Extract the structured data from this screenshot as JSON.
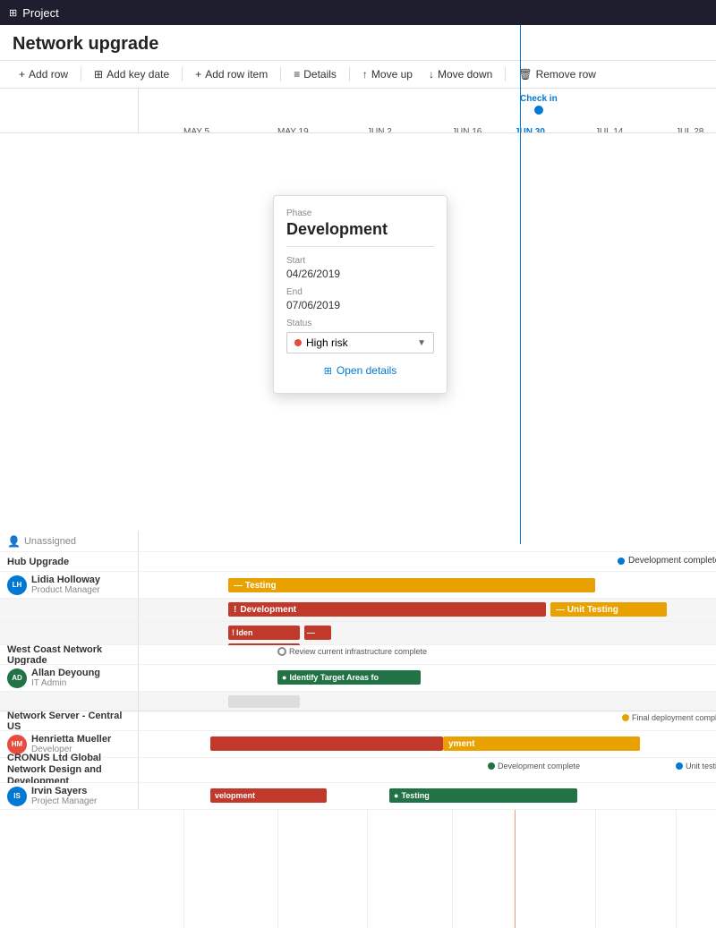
{
  "app": {
    "title": "Project"
  },
  "page": {
    "title": "Network upgrade"
  },
  "toolbar": {
    "buttons": [
      {
        "id": "add-row",
        "label": "Add row",
        "icon": "plus"
      },
      {
        "id": "add-key-date",
        "label": "Add key date",
        "icon": "grid"
      },
      {
        "id": "add-row-item",
        "label": "Add row item",
        "icon": "plus"
      },
      {
        "id": "details",
        "label": "Details",
        "icon": "details"
      },
      {
        "id": "move-up",
        "label": "Move up",
        "icon": "up"
      },
      {
        "id": "move-down",
        "label": "Move down",
        "icon": "down"
      },
      {
        "id": "remove-row",
        "label": "Remove row",
        "icon": "trash"
      }
    ]
  },
  "timeline": {
    "checkin_label": "Check in",
    "dates": [
      "MAY 5",
      "MAY 19",
      "JUN 2",
      "JUN 16",
      "JUN 30",
      "JUL 14",
      "JUL 28"
    ],
    "checkin_date": "JUN 30"
  },
  "sections": [
    {
      "id": "unassigned",
      "label": "Unassigned",
      "rows": []
    },
    {
      "id": "hub-upgrade",
      "label": "Hub Upgrade",
      "person_name": "Lidia Holloway",
      "person_role": "Product Manager",
      "avatar_initials": "LH",
      "avatar_color": "#0078d4",
      "bars": [
        {
          "label": "Testing",
          "color": "orange",
          "style": "left:115px;width:380px;top:4px;"
        },
        {
          "label": "Development",
          "color": "red",
          "style": "left:115px;width:310px;top:4px;"
        },
        {
          "label": "Unit Testing",
          "color": "orange",
          "style": "left:465px;width:120px;top:4px;"
        }
      ],
      "milestone": {
        "label": "Development complete",
        "style": "left:530px;top:2px;",
        "color": "#0078d4"
      }
    },
    {
      "id": "west-coast",
      "label": "West Coast Network Upgrade",
      "person_name": "Allan Deyoung",
      "person_role": "IT Admin",
      "avatar_initials": "AD",
      "avatar_color": "#217346",
      "milestone_label": "Review current infrastructure complete",
      "bars": [
        {
          "label": "Identify Target Areas fo",
          "color": "green",
          "style": "left:165px;width:140px;top:4px;"
        }
      ]
    },
    {
      "id": "network-server",
      "label": "Network Server - Central US",
      "person_name": "Henrietta Mueller",
      "person_role": "Developer",
      "avatar_initials": "HM",
      "avatar_color": "#e74c3c",
      "bars": [
        {
          "label": "",
          "color": "red-wide",
          "style": "left:100px;width:240px;top:4px;"
        },
        {
          "label": "yment",
          "color": "orange",
          "style": "left:330px;width:220px;top:4px;"
        }
      ],
      "milestone": {
        "label": "Final deployment complete",
        "style": "left:555px;top:2px;",
        "color": "#e8a100"
      }
    },
    {
      "id": "cronus",
      "label": "CRONUS Ltd Global Network Design and Development",
      "person_name": "Irvin Sayers",
      "person_role": "Project Manager",
      "avatar_initials": "IS",
      "avatar_color": "#0078d4",
      "bars": [
        {
          "label": "velopment",
          "color": "red",
          "style": "left:100px;width:120px;top:4px;"
        },
        {
          "label": "Testing",
          "color": "green",
          "style": "left:290px;width:200px;top:4px;"
        }
      ],
      "milestones": [
        {
          "label": "Development complete",
          "style": "left:405px;top:2px;",
          "color": "#217346"
        },
        {
          "label": "Unit testing complete",
          "style": "left:610px;top:2px;",
          "color": "#0078d4"
        }
      ]
    }
  ],
  "popup": {
    "section_label": "Phase",
    "title": "Development",
    "start_label": "Start",
    "start_value": "04/26/2019",
    "end_label": "End",
    "end_value": "07/06/2019",
    "status_label": "Status",
    "status_value": "High risk",
    "status_color": "#e74c3c",
    "open_details_label": "Open details"
  }
}
